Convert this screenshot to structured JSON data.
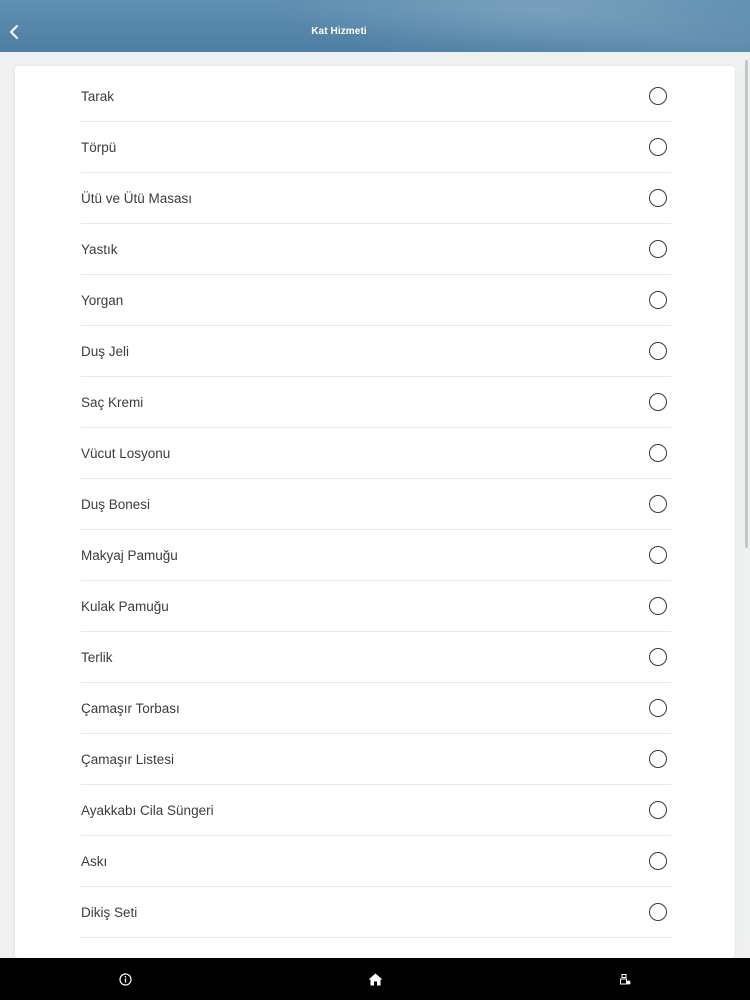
{
  "header": {
    "title": "Kat Hizmeti",
    "back_icon": "chevron-left-icon"
  },
  "items": [
    {
      "label": "Tarak",
      "selected": false
    },
    {
      "label": "Törpü",
      "selected": false
    },
    {
      "label": "Ütü ve Ütü Masası",
      "selected": false
    },
    {
      "label": "Yastık",
      "selected": false
    },
    {
      "label": "Yorgan",
      "selected": false
    },
    {
      "label": "Duş Jeli",
      "selected": false
    },
    {
      "label": "Saç Kremi",
      "selected": false
    },
    {
      "label": "Vücut Losyonu",
      "selected": false
    },
    {
      "label": "Duş Bonesi",
      "selected": false
    },
    {
      "label": "Makyaj Pamuğu",
      "selected": false
    },
    {
      "label": "Kulak Pamuğu",
      "selected": false
    },
    {
      "label": "Terlik",
      "selected": false
    },
    {
      "label": "Çamaşır Torbası",
      "selected": false
    },
    {
      "label": "Çamaşır Listesi",
      "selected": false
    },
    {
      "label": "Ayakkabı Cila Süngeri",
      "selected": false
    },
    {
      "label": "Askı",
      "selected": false
    },
    {
      "label": "Dikiş Seti",
      "selected": false
    }
  ],
  "footer": {
    "icons": [
      "info-icon",
      "home-icon",
      "bell-user-icon"
    ]
  },
  "colors": {
    "header_bg": "#527fa1",
    "footer_bg": "#000000",
    "text": "#3c3c3c"
  }
}
